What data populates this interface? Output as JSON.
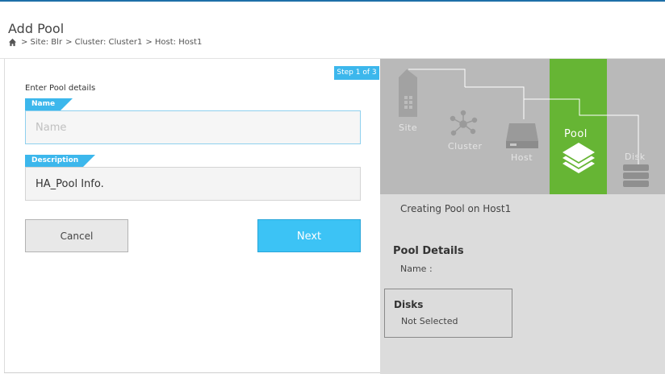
{
  "header": {
    "title": "Add Pool",
    "breadcrumb": [
      {
        "label": "> Site: Blr"
      },
      {
        "label": "> Cluster: Cluster1"
      },
      {
        "label": "> Host: Host1"
      }
    ]
  },
  "wizard": {
    "step_label": "Step 1 of 3",
    "heading": "Enter Pool details",
    "name_tag": "Name",
    "name_value": "",
    "name_placeholder": "Name",
    "description_tag": "Description",
    "description_value": "HA_Pool Info.",
    "cancel_label": "Cancel",
    "next_label": "Next"
  },
  "diagram": {
    "nodes": [
      {
        "label": "Site",
        "icon": "building-icon"
      },
      {
        "label": "Cluster",
        "icon": "network-icon"
      },
      {
        "label": "Host",
        "icon": "server-icon"
      },
      {
        "label": "Pool",
        "icon": "layers-icon",
        "active": true
      },
      {
        "label": "Disk",
        "icon": "disk-stack-icon"
      }
    ],
    "active_color": "#66b534",
    "inactive_color": "#b9b9b9"
  },
  "summary": {
    "creating_text": "Creating Pool on Host1",
    "pool_details_title": "Pool Details",
    "name_label": "Name :",
    "disks_title": "Disks",
    "disks_value": "Not Selected"
  },
  "colors": {
    "accent": "#3cb7ec",
    "next_button": "#3cc3f5",
    "pool_active": "#66b534"
  }
}
